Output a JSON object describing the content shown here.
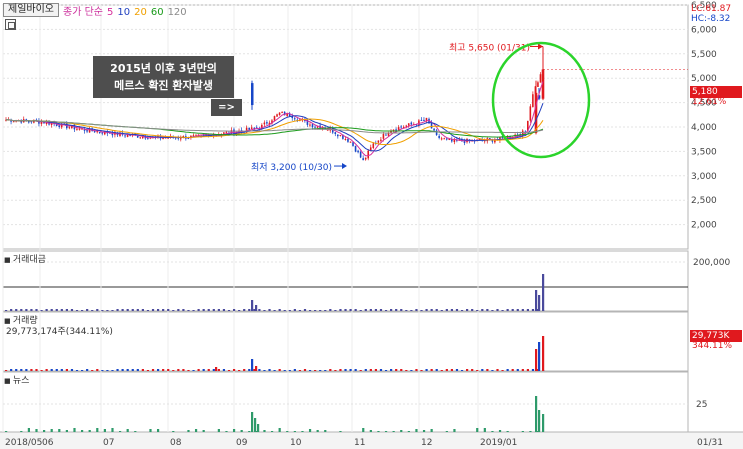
{
  "header": {
    "stock_name": "제일바이오",
    "ma_legend": [
      {
        "label": "종가 단순",
        "color": "#cc2f9c"
      },
      {
        "label": "5",
        "color": "#d62d9a"
      },
      {
        "label": "10",
        "color": "#1f3fbf"
      },
      {
        "label": "20",
        "color": "#f0a000"
      },
      {
        "label": "60",
        "color": "#1a9a1a"
      },
      {
        "label": "120",
        "color": "#8a8a8a"
      }
    ],
    "lc": "LC:61.87",
    "hc": "HC:-8.32"
  },
  "annotation": {
    "line1": "2015년 이후 3년만의",
    "line2": "메르스 확진 환자발생",
    "arrow": "=>"
  },
  "price_badge": {
    "price": "5,180",
    "change": "12.61%"
  },
  "volume_badge": {
    "value": "29,773K",
    "ratio": "344.11%"
  },
  "panels": {
    "amount_label": "거래대금",
    "volume_label": "거래량",
    "volume_detail": "29,773,174주(344.11%)",
    "news_label": "뉴스"
  },
  "colors": {
    "up": "#e0191e",
    "down": "#1646c8",
    "bar_blue": "#4a4a9c",
    "news": "#2e9a6a",
    "circle": "#2bd42b"
  },
  "chart_data": [
    {
      "type": "candlestick",
      "panel": "price",
      "title": "",
      "xlabel": "",
      "ylabel": "",
      "ylim": [
        1500,
        6500
      ],
      "yticks": [
        2000,
        2500,
        3000,
        3500,
        4000,
        4500,
        5000,
        5500,
        6000,
        6500
      ],
      "ytick_labels": [
        "2,000",
        "2,500",
        "3,000",
        "3,500",
        "4,000",
        "4,500",
        "5,000",
        "5,500",
        "6,000",
        "6,500"
      ],
      "x_labels": [
        "2018/05",
        "06",
        "07",
        "08",
        "09",
        "10",
        "11",
        "12",
        "2019/01",
        "01/31"
      ],
      "moving_averages": [
        5,
        10,
        20,
        60,
        120
      ],
      "annotations": [
        {
          "label": "최고 5,650 (01/31)",
          "date": "01/31",
          "value": 5650
        },
        {
          "label": "최저 3,200 (10/30)",
          "date": "10/30",
          "value": 3200
        }
      ],
      "last_close": 5180,
      "last_change_pct": 12.61,
      "grid": true
    },
    {
      "type": "bar",
      "panel": "trading_value",
      "title": "거래대금",
      "yticks": [
        200000
      ],
      "ytick_labels": [
        "200,000"
      ],
      "grid": true
    },
    {
      "type": "bar",
      "panel": "volume",
      "title": "거래량",
      "last_value": 29773174,
      "last_ratio_pct": 344.11,
      "grid": true
    },
    {
      "type": "bar",
      "panel": "news",
      "title": "뉴스",
      "yticks": [
        25
      ],
      "ytick_labels": [
        "25"
      ],
      "grid": true
    }
  ]
}
